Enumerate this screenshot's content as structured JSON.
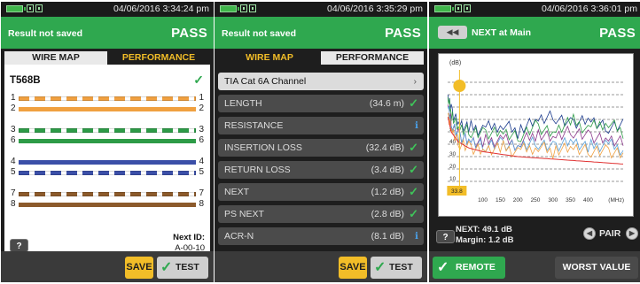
{
  "panels": [
    {
      "datetime": "04/06/2016 3:34:24 pm",
      "status": "Result not saved",
      "result": "PASS",
      "tabs": [
        "WIRE MAP",
        "PERFORMANCE"
      ],
      "active_tab": "PERFORMANCE",
      "standard": "T568B",
      "wires": [
        {
          "left": "1",
          "right": "1",
          "colors": [
            "#f0a040",
            "#ffffff"
          ]
        },
        {
          "left": "2",
          "right": "2",
          "colors": [
            "#f0a040",
            "#f0a040"
          ]
        },
        {
          "left": "3",
          "right": "3",
          "colors": [
            "#2d9b47",
            "#ffffff"
          ]
        },
        {
          "left": "6",
          "right": "6",
          "colors": [
            "#2d9b47",
            "#2d9b47"
          ]
        },
        {
          "left": "4",
          "right": "4",
          "colors": [
            "#3b4fa8",
            "#3b4fa8"
          ]
        },
        {
          "left": "5",
          "right": "5",
          "colors": [
            "#3b4fa8",
            "#ffffff"
          ]
        },
        {
          "left": "7",
          "right": "7",
          "colors": [
            "#8c5a2b",
            "#ffffff"
          ]
        },
        {
          "left": "8",
          "right": "8",
          "colors": [
            "#8c5a2b",
            "#8c5a2b"
          ]
        }
      ],
      "help": "?",
      "next_id_label": "Next ID:",
      "next_id": "A-00-10",
      "save": "SAVE",
      "test": "TEST"
    },
    {
      "datetime": "04/06/2016 3:35:29 pm",
      "status": "Result not saved",
      "result": "PASS",
      "tabs": [
        "WIRE MAP",
        "PERFORMANCE"
      ],
      "active_tab": "WIRE MAP",
      "limit": "TIA Cat 6A Channel",
      "rows": [
        {
          "label": "LENGTH",
          "value": "(34.6 m)",
          "mark": "check"
        },
        {
          "label": "RESISTANCE",
          "value": "",
          "mark": "info"
        },
        {
          "label": "INSERTION LOSS",
          "value": "(32.4 dB)",
          "mark": "check"
        },
        {
          "label": "RETURN LOSS",
          "value": "(3.4 dB)",
          "mark": "check"
        },
        {
          "label": "NEXT",
          "value": "(1.2 dB)",
          "mark": "check"
        },
        {
          "label": "PS NEXT",
          "value": "(2.8 dB)",
          "mark": "check"
        },
        {
          "label": "ACR-N",
          "value": "(8.1 dB)",
          "mark": "info"
        }
      ],
      "save": "SAVE",
      "test": "TEST"
    },
    {
      "datetime": "04/06/2016 3:36:01 pm",
      "title": "NEXT at Main",
      "result": "PASS",
      "help": "?",
      "next_label": "NEXT:",
      "next_value": "49.1 dB",
      "margin_label": "Margin:",
      "margin_value": "1.2 dB",
      "pair": "PAIR",
      "remote": "REMOTE",
      "worst": "WORST VALUE"
    }
  ],
  "chart_data": {
    "type": "line",
    "title": "",
    "xlabel": "(MHz)",
    "ylabel": "(dB)",
    "xlim": [
      0,
      500
    ],
    "ylim": [
      0,
      100
    ],
    "x_ticks": [
      100,
      150,
      200,
      250,
      300,
      350,
      400
    ],
    "y_ticks": [
      10,
      20,
      30,
      40,
      50
    ],
    "cursor_value": "33.8",
    "cursor_x": 33.8,
    "grid": true,
    "series": [
      {
        "color": "#1a3a8c",
        "values": [
          [
            1,
            80
          ],
          [
            10,
            68
          ],
          [
            30,
            58
          ],
          [
            60,
            54
          ],
          [
            100,
            52
          ],
          [
            150,
            56
          ],
          [
            200,
            50
          ],
          [
            250,
            58
          ],
          [
            300,
            62
          ],
          [
            350,
            56
          ],
          [
            400,
            60
          ],
          [
            450,
            54
          ],
          [
            500,
            56
          ]
        ]
      },
      {
        "color": "#2d9b47",
        "values": [
          [
            1,
            78
          ],
          [
            10,
            64
          ],
          [
            30,
            52
          ],
          [
            60,
            50
          ],
          [
            100,
            48
          ],
          [
            150,
            50
          ],
          [
            200,
            46
          ],
          [
            250,
            55
          ],
          [
            300,
            50
          ],
          [
            350,
            60
          ],
          [
            400,
            52
          ],
          [
            450,
            58
          ],
          [
            500,
            50
          ]
        ]
      },
      {
        "color": "#8c3a8c",
        "values": [
          [
            1,
            72
          ],
          [
            10,
            58
          ],
          [
            30,
            48
          ],
          [
            60,
            44
          ],
          [
            100,
            42
          ],
          [
            150,
            44
          ],
          [
            200,
            40
          ],
          [
            250,
            48
          ],
          [
            300,
            44
          ],
          [
            350,
            50
          ],
          [
            400,
            46
          ],
          [
            450,
            44
          ],
          [
            500,
            42
          ]
        ]
      },
      {
        "color": "#5aa0d8",
        "values": [
          [
            1,
            70
          ],
          [
            10,
            56
          ],
          [
            30,
            46
          ],
          [
            60,
            42
          ],
          [
            100,
            38
          ],
          [
            150,
            40
          ],
          [
            200,
            38
          ],
          [
            250,
            42
          ],
          [
            300,
            38
          ],
          [
            350,
            44
          ],
          [
            400,
            38
          ],
          [
            450,
            40
          ],
          [
            500,
            36
          ]
        ]
      },
      {
        "color": "#f0a040",
        "values": [
          [
            1,
            64
          ],
          [
            10,
            52
          ],
          [
            30,
            42
          ],
          [
            60,
            38
          ],
          [
            100,
            36
          ],
          [
            150,
            38
          ],
          [
            200,
            34
          ],
          [
            250,
            38
          ],
          [
            300,
            34
          ],
          [
            350,
            36
          ],
          [
            400,
            34
          ],
          [
            450,
            34
          ],
          [
            500,
            32
          ]
        ]
      },
      {
        "color": "#e03030",
        "values": [
          [
            1,
            62
          ],
          [
            10,
            50
          ],
          [
            30,
            42
          ],
          [
            60,
            37
          ],
          [
            100,
            34
          ],
          [
            150,
            32
          ],
          [
            200,
            30
          ],
          [
            250,
            29
          ],
          [
            300,
            28
          ],
          [
            350,
            27
          ],
          [
            400,
            26
          ],
          [
            450,
            25
          ],
          [
            500,
            24
          ]
        ]
      }
    ]
  }
}
